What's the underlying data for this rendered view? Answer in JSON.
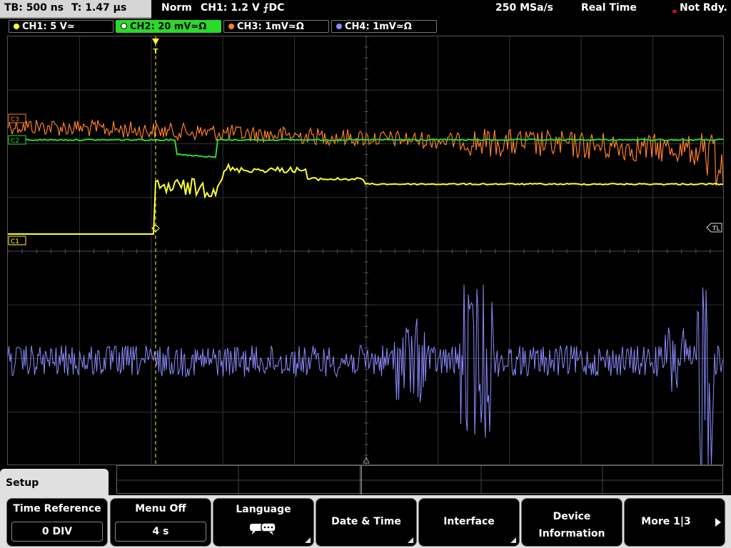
{
  "status_bar": {
    "timebase": "TB: 500 ns",
    "trigger_time": "T: 1.47 µs",
    "trigger_mode": "Norm",
    "trigger_setting": "CH1: 1.2 V ⨍DC",
    "sample_rate": "250 MSa/s",
    "acq_mode": "Real Time",
    "acq_status": "Not Rdy."
  },
  "channels": [
    {
      "label": "CH1: 5 V≃",
      "color": "#ffff33"
    },
    {
      "label": "CH2: 20 mV≃Ω",
      "color": "#2adb2a"
    },
    {
      "label": "CH3: 1mV≃Ω",
      "color": "#ff7f27"
    },
    {
      "label": "CH4: 1mV≃Ω",
      "color": "#8c8cff"
    }
  ],
  "screen_markers": {
    "ch1": "C1",
    "ch2": "C2",
    "ch3": "C3",
    "trigger_level": "TL",
    "trigger_pos": "T"
  },
  "menu": {
    "title": "Setup",
    "softkeys": [
      {
        "label": "Time Reference",
        "value": "0 DIV"
      },
      {
        "label": "Menu Off",
        "value": "4 s"
      },
      {
        "label": "Language",
        "icon": "speech-bubbles-icon"
      },
      {
        "label": "Date & Time"
      },
      {
        "label": "Interface"
      },
      {
        "label": "Device Information"
      },
      {
        "label": "More 1|3"
      }
    ]
  }
}
